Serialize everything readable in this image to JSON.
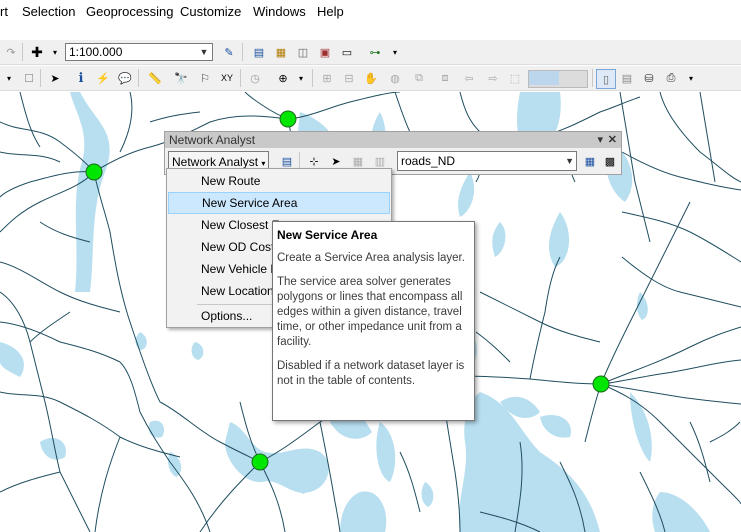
{
  "menubar": {
    "items": [
      "rt",
      "Selection",
      "Geoprocessing",
      "Customize",
      "Windows",
      "Help"
    ]
  },
  "standard_toolbar": {
    "scale": "1:100.000"
  },
  "network_analyst": {
    "title": "Network Analyst",
    "dropdown_label": "Network Analyst",
    "dataset": "roads_ND",
    "menu": [
      "New Route",
      "New Service Area",
      "New Closest F",
      "New OD Cost",
      "New Vehicle F",
      "New Location",
      "Options..."
    ],
    "highlighted": "New Service Area"
  },
  "tooltip": {
    "title": "New Service Area",
    "line1": "Create a Service Area analysis layer.",
    "line2": "The service area solver generates polygons or lines that encompass all edges within a given distance, travel time, or other impedance unit from a facility.",
    "line3": "Disabled if a network dataset layer is not in the table of contents."
  },
  "colors": {
    "road": "#1f4e5f",
    "water": "#b8dff0",
    "node": "#00e600",
    "highlight": "#cce8ff"
  }
}
